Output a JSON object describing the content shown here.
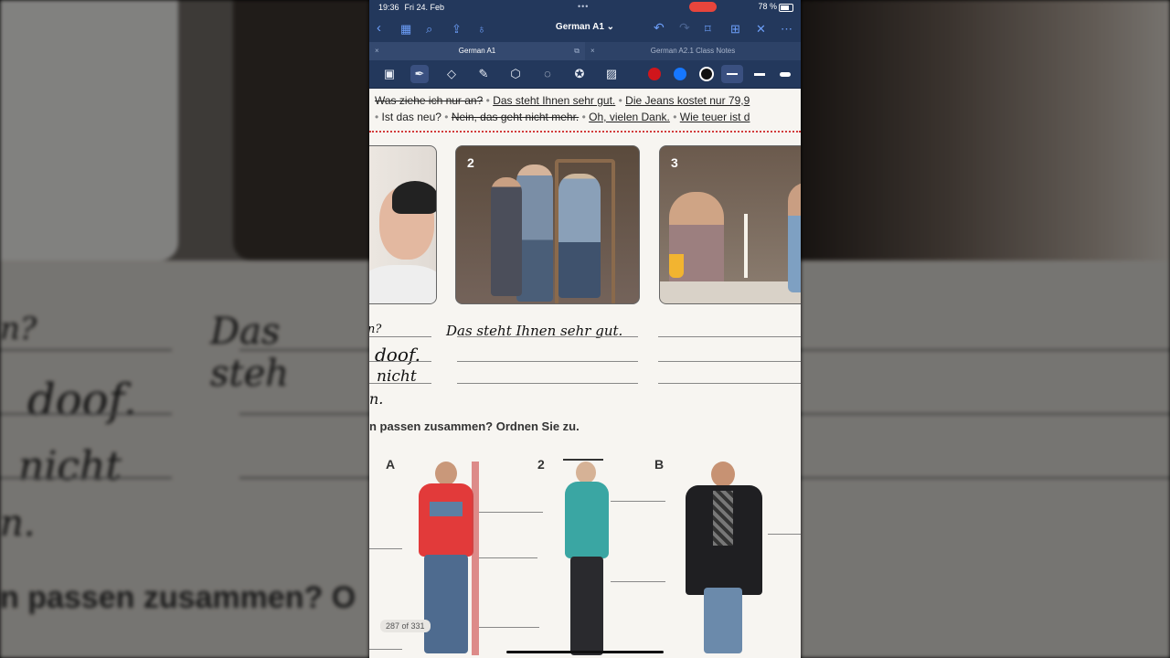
{
  "status": {
    "time": "19:36",
    "date": "Fri 24. Feb",
    "battery": "78 %"
  },
  "nav": {
    "title": "German A1 ⌄"
  },
  "tabs": [
    {
      "label": "German A1"
    },
    {
      "label": "German A2.1 Class Notes"
    }
  ],
  "colors": {
    "ink_red": "#d0161c",
    "ink_blue": "#1677ff",
    "ink_black": "#111111",
    "accent": "#23385c"
  },
  "book": {
    "line1": {
      "s1": "Was ziehe ich nur an?",
      "s2": "Das steht Ihnen sehr gut.",
      "s3": "Die Jeans kostet nur 79,9"
    },
    "line2": {
      "s1": "Ist das neu?",
      "s2": "Nein, das geht nicht mehr.",
      "s3": "Oh, vielen Dank.",
      "s4": "Wie teuer ist d"
    },
    "photo_numbers": [
      "2",
      "3"
    ],
    "exercise_text": "n passen zusammen? Ordnen Sie zu.",
    "labels": [
      "A",
      "2",
      "B"
    ]
  },
  "handwriting": {
    "answer": "Das steht Ihnen sehr gut.",
    "left_q": "n?",
    "left_doof": "doof.",
    "left_nicht": "nicht",
    "left_n": "n."
  },
  "backdrop": {
    "left_q": "n?",
    "left_hw": "Das steh",
    "left_doof": "doof.",
    "left_nicht": "nicht",
    "left_n": "n.",
    "left_print": "n passen zusammen? O"
  },
  "page_indicator": "287 of 331"
}
